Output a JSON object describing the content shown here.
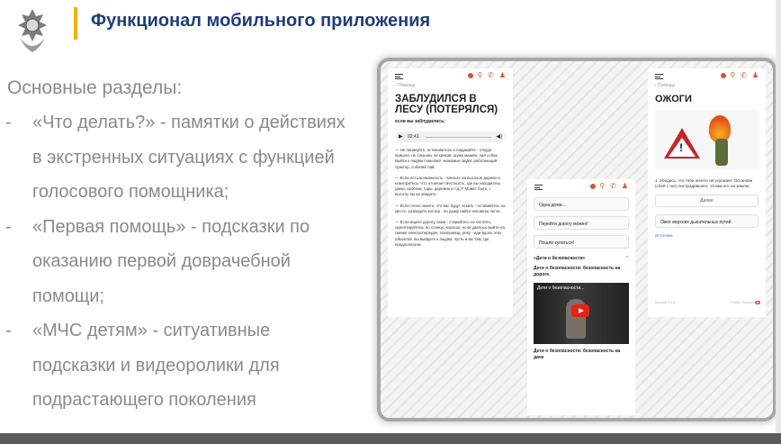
{
  "colors": {
    "accent_bar": "#f2b200",
    "title": "#1f3d7a",
    "body_text": "#8a8a8a",
    "app_accent": "#d2553a"
  },
  "header": {
    "title": "Функционал мобильного приложения",
    "emblem_icon": "mchs-emblem-icon"
  },
  "content": {
    "heading": "Основные разделы:",
    "bullets": [
      {
        "marker": "-",
        "lines": [
          "«Что делать?» - памятки о действиях",
          "в экстренных ситуациях с функцией",
          "голосового помощника;"
        ]
      },
      {
        "marker": "-",
        "lines": [
          "«Первая помощь» - подсказки по",
          "оказанию первой доврачебной",
          "помощи;"
        ]
      },
      {
        "marker": "-",
        "lines": [
          "«МЧС детям» - ситуативные",
          "подсказки и видеоролики для",
          "подрастающего поколения"
        ]
      }
    ]
  },
  "phone_lost": {
    "breadcrumb": "‹ Помощь",
    "title": "ЗАБЛУДИЛСЯ В ЛЕСУ (ПОТЕРЯЛСЯ)",
    "subtitle": "если вы заблудились:",
    "player_time": "02:41",
    "paragraphs": [
      "— Не паникуйте, остановитесь и подумайте - откуда пришли, не слышны ли криков, шума машин, лая собак. Выйти к людям помогают знакомые звуки: работающий трактор, собачий лай.",
      "— Если есть возможность - влезьте на высокое дерево и осмотритесь. Что отличает местность, где вы находитесь (реки, просеки, горы, деревни и т.д.)? Может быть, с высоты вы их увидите.",
      "— Если точно знаете, что вас будут искать - оставайтесь на месте, разведите костер - по дыму найти человека легче.",
      "— Если ищите дорогу сами - старайтесь не петлять, ориентируйтесь по солнцу. Хорошо, если удалось выйти на линию электропередач, газопровод, реку - иди вдоль этих объектов, вы выйдете к людям, пусть и вы там, где предполагали."
    ]
  },
  "phone_kids": {
    "items": [
      "Одна дома...",
      "Перейти дорогу можно!",
      "Пошли купаться!"
    ],
    "accordion_title": "«Дети о безопасности»",
    "video_caption_1": "Дети о безопасности: безопасность на дороге.",
    "video_overlay": "Дети о безопасности...",
    "video_caption_2": "Дети о безопасности: безопасность на даче"
  },
  "phone_burns": {
    "breadcrumb": "‹ Помощь",
    "title": "ОЖОГИ",
    "step_text": "1. Убедись, что тебе ничего не угрожает. Останови (сбей с ног) пострадавшего. Уложи его на землю;",
    "next_button": "Далее",
    "option_text": "Ожог верхних дыхательных путей",
    "source_link": "Источник",
    "version": "Версия 1.2.6",
    "copyright": "© МЧС России"
  }
}
